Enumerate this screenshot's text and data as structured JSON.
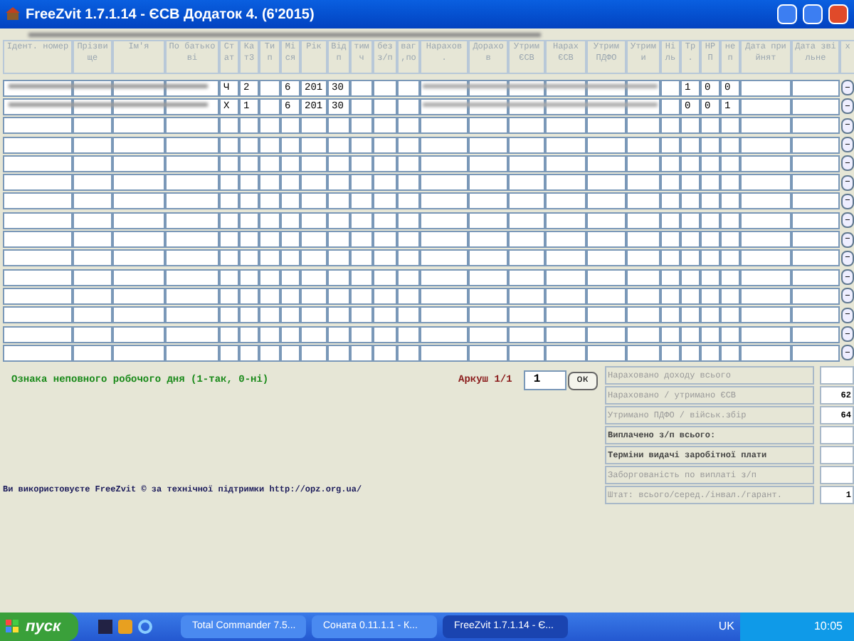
{
  "window": {
    "title": "FreeZvit 1.7.1.14 - ЄСВ Додаток 4. (6'2015)"
  },
  "table": {
    "columns": [
      "Ідент. номер",
      "Прізвище",
      "Ім'я",
      "По батькові",
      "Ст ат",
      "Ка т3",
      "Ти п",
      "Мі ся",
      "Рік",
      "Від п",
      "тим ч",
      "без з/п",
      "ваг ,по",
      "Нарахов .",
      "Дорахо в",
      "Утрим ЄСВ",
      "Нарах ЄСВ",
      "Утрим ПДФО",
      "Утрим и",
      "Ні ль",
      "Тр .",
      "НР П",
      "не п",
      "Дата прийнят",
      "Дата звільне",
      "х"
    ],
    "rows": [
      {
        "redacted": true,
        "cells": [
          "",
          "",
          "",
          "",
          "Ч",
          "2",
          "",
          "6",
          "201",
          "30",
          "",
          "",
          "",
          "",
          "",
          "",
          "",
          "",
          "",
          "",
          "1",
          "0",
          "0",
          "",
          ""
        ]
      },
      {
        "redacted": true,
        "cells": [
          "",
          "",
          "",
          "",
          "Х",
          "1",
          "",
          "6",
          "201",
          "30",
          "",
          "",
          "",
          "",
          "",
          "",
          "",
          "",
          "",
          "",
          "0",
          "0",
          "1",
          "",
          ""
        ]
      },
      {
        "redacted": false,
        "cells": []
      },
      {
        "redacted": false,
        "cells": []
      },
      {
        "redacted": false,
        "cells": []
      },
      {
        "redacted": false,
        "cells": []
      },
      {
        "redacted": false,
        "cells": []
      },
      {
        "redacted": false,
        "cells": []
      },
      {
        "redacted": false,
        "cells": []
      },
      {
        "redacted": false,
        "cells": []
      },
      {
        "redacted": false,
        "cells": []
      },
      {
        "redacted": false,
        "cells": []
      },
      {
        "redacted": false,
        "cells": []
      },
      {
        "redacted": false,
        "cells": []
      },
      {
        "redacted": false,
        "cells": []
      }
    ],
    "row_button": "–"
  },
  "hint": "Ознака неповного робочого дня (1-так, 0-ні)",
  "sheet": {
    "label": "Аркуш 1/1",
    "value": "1",
    "button": "ок"
  },
  "summary": [
    {
      "label": "Нараховано доходу всього",
      "bold": false
    },
    {
      "label": "Нараховано / утримано ЄСВ",
      "value": "62",
      "bold": false
    },
    {
      "label": "Утримано ПДФО / військ.збір",
      "value": "64",
      "bold": false
    },
    {
      "label": "Виплачено з/п всього:",
      "bold": true
    },
    {
      "label": "Терміни видачі заробітної плати",
      "bold": true
    },
    {
      "label": "Заборгованість по виплаті з/п",
      "bold": false
    },
    {
      "label": "Штат: всього/серед./інвал./гарант.",
      "value": "1",
      "bold": false
    }
  ],
  "footer": "Ви використовуєте FreeZvit © за технічної підтримки http://opz.org.ua/",
  "taskbar": {
    "start": "пуск",
    "tasks": [
      {
        "label": "Total Commander 7.5...",
        "selected": false
      },
      {
        "label": "Соната 0.11.1.1 - К...",
        "selected": false
      },
      {
        "label": "FreeZvit 1.7.1.14 - Є...",
        "selected": true
      }
    ],
    "language": "UK",
    "clock": "10:05"
  }
}
